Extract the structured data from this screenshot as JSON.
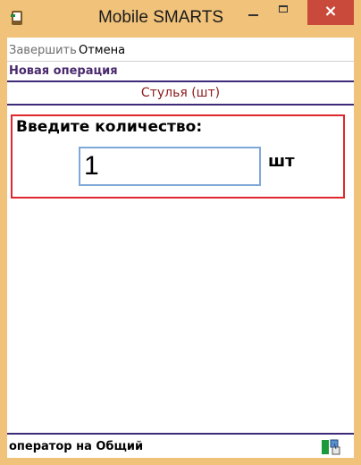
{
  "window": {
    "title": "Mobile SMARTS",
    "close_glyph": "×",
    "accent_color": "#f0c27a",
    "close_color": "#c94a3a"
  },
  "menu": {
    "finish_label": "Завершить",
    "cancel_label": "Отмена"
  },
  "operation": {
    "title": "Новая операция",
    "product": "Стулья (шт)"
  },
  "quantity": {
    "prompt": "Введите количество:",
    "value": "1",
    "unit": "шт",
    "highlight_color": "#e0272d"
  },
  "status": {
    "text": "оператор на Общий",
    "icon": "connection-status-icon"
  }
}
